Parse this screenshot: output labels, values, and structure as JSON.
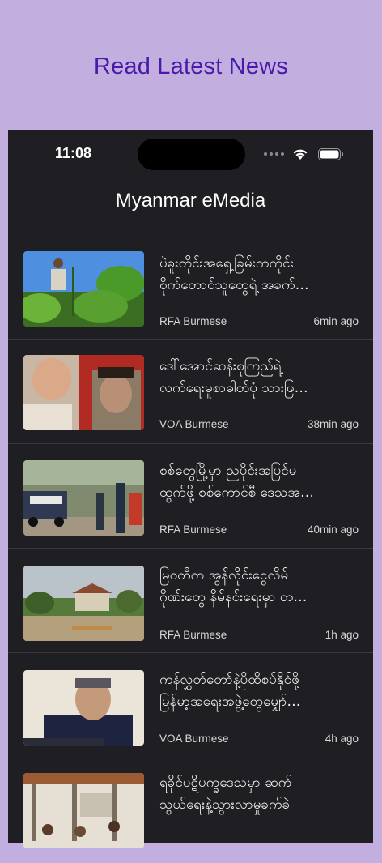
{
  "promo": {
    "title": "Read Latest News"
  },
  "status_bar": {
    "time": "11:08",
    "icons": [
      "signal-dots-icon",
      "wifi-icon",
      "battery-icon"
    ]
  },
  "app": {
    "title": "Myanmar eMedia"
  },
  "news": [
    {
      "line1": "ပဲခူးတိုင်းအရှေ့ခြမ်းကကိုင်း",
      "line2": "စိုက်တောင်သူတွေရဲ့ အခက်…",
      "source": "RFA Burmese",
      "ago": "6min ago",
      "image": "farmer-photo"
    },
    {
      "line1": "ဒေါ်အောင်ဆန်းစုကြည်ရဲ့",
      "line2": "လက်ရေးမူစာဓါတ်ပုံ သားဖြ…",
      "source": "VOA Burmese",
      "ago": "38min ago",
      "image": "portrait-photo"
    },
    {
      "line1": "စစ်တွေမြို့မှာ ညပိုင်းအပြင်မ",
      "line2": "ထွက်ဖို့ စစ်ကောင်စီ ဒေသအ…",
      "source": "RFA Burmese",
      "ago": "40min ago",
      "image": "police-photo"
    },
    {
      "line1": "မြဝတီက အွန်လိုင်းငွေလိမ်",
      "line2": "ဂိုဏ်းတွေ နိမ်နင်းရေးမှာ တ…",
      "source": "RFA Burmese",
      "ago": "1h ago",
      "image": "village-photo"
    },
    {
      "line1": "ကန်လွှတ်တော်နဲ့ပိုထိစပ်နိုင်ဖို့",
      "line2": "မြန်မာ့အရေးအဖွဲ့တွေမျှော်…",
      "source": "VOA Burmese",
      "ago": "4h ago",
      "image": "interview-photo"
    },
    {
      "line1": "ရခိုင်ပဋိပက္ခဒေသမှာ ဆက်",
      "line2": "သွယ်ရေးနဲ့သွားလာမှုခက်ခဲ",
      "source": "",
      "ago": "",
      "image": "camp-photo"
    }
  ]
}
